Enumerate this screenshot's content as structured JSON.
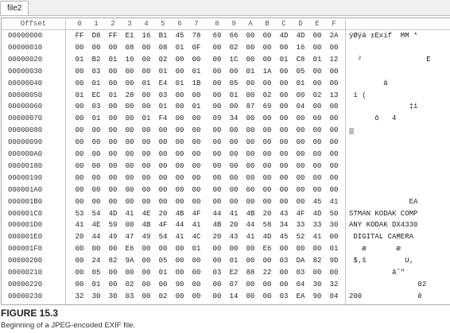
{
  "tab": {
    "label": "file2"
  },
  "header": {
    "offset_label": "Offset",
    "columns": [
      "0",
      "1",
      "2",
      "3",
      "4",
      "5",
      "6",
      "7",
      "8",
      "9",
      "A",
      "B",
      "C",
      "D",
      "E",
      "F"
    ]
  },
  "rows": [
    {
      "offset": "00000000",
      "hex": [
        "FF",
        "D8",
        "FF",
        "E1",
        "16",
        "B1",
        "45",
        "78",
        "69",
        "66",
        "00",
        "00",
        "4D",
        "4D",
        "00",
        "2A"
      ],
      "ascii": "ÿØÿá ±Exif  MM *"
    },
    {
      "offset": "00000010",
      "hex": [
        "00",
        "00",
        "00",
        "08",
        "00",
        "08",
        "01",
        "0F",
        "00",
        "02",
        "00",
        "00",
        "00",
        "16",
        "00",
        "00"
      ],
      "ascii": ""
    },
    {
      "offset": "00000020",
      "hex": [
        "01",
        "B2",
        "01",
        "10",
        "00",
        "02",
        "00",
        "00",
        "00",
        "1C",
        "00",
        "00",
        "01",
        "C8",
        "01",
        "12"
      ],
      "ascii": "  ²               È"
    },
    {
      "offset": "00000030",
      "hex": [
        "00",
        "03",
        "00",
        "00",
        "00",
        "01",
        "00",
        "01",
        "00",
        "00",
        "01",
        "1A",
        "00",
        "05",
        "00",
        "00"
      ],
      "ascii": ""
    },
    {
      "offset": "00000040",
      "hex": [
        "00",
        "01",
        "00",
        "00",
        "01",
        "E4",
        "01",
        "1B",
        "00",
        "05",
        "00",
        "00",
        "00",
        "01",
        "00",
        "00"
      ],
      "ascii": "        ä"
    },
    {
      "offset": "00000050",
      "hex": [
        "01",
        "EC",
        "01",
        "28",
        "00",
        "03",
        "00",
        "00",
        "00",
        "01",
        "00",
        "02",
        "00",
        "00",
        "02",
        "13"
      ],
      "ascii": " ì ("
    },
    {
      "offset": "00000060",
      "hex": [
        "00",
        "03",
        "00",
        "00",
        "00",
        "01",
        "00",
        "01",
        "00",
        "00",
        "87",
        "69",
        "00",
        "04",
        "00",
        "00"
      ],
      "ascii": "              ‡i"
    },
    {
      "offset": "00000070",
      "hex": [
        "00",
        "01",
        "00",
        "00",
        "01",
        "F4",
        "00",
        "00",
        "09",
        "34",
        "00",
        "00",
        "00",
        "00",
        "00",
        "00"
      ],
      "ascii": "      ô   4"
    },
    {
      "offset": "00000080",
      "hex": [
        "00",
        "00",
        "00",
        "00",
        "00",
        "00",
        "00",
        "00",
        "00",
        "00",
        "00",
        "00",
        "00",
        "00",
        "00",
        "00"
      ],
      "ascii": ""
    },
    {
      "offset": "00000090",
      "hex": [
        "00",
        "00",
        "00",
        "00",
        "00",
        "00",
        "00",
        "00",
        "00",
        "00",
        "00",
        "00",
        "00",
        "00",
        "00",
        "00"
      ],
      "ascii": ""
    },
    {
      "offset": "000000A0",
      "hex": [
        "00",
        "00",
        "00",
        "00",
        "00",
        "00",
        "00",
        "00",
        "00",
        "00",
        "00",
        "00",
        "00",
        "00",
        "00",
        "00"
      ],
      "ascii": ""
    },
    {
      "offset": "00000180",
      "hex": [
        "00",
        "00",
        "00",
        "00",
        "00",
        "00",
        "00",
        "00",
        "00",
        "00",
        "00",
        "00",
        "00",
        "00",
        "00",
        "00"
      ],
      "ascii": ""
    },
    {
      "offset": "00000190",
      "hex": [
        "00",
        "00",
        "00",
        "00",
        "00",
        "00",
        "00",
        "00",
        "00",
        "00",
        "00",
        "00",
        "00",
        "00",
        "00",
        "00"
      ],
      "ascii": ""
    },
    {
      "offset": "000001A0",
      "hex": [
        "00",
        "00",
        "00",
        "00",
        "00",
        "00",
        "00",
        "00",
        "00",
        "00",
        "00",
        "00",
        "00",
        "00",
        "00",
        "00"
      ],
      "ascii": ""
    },
    {
      "offset": "000001B0",
      "hex": [
        "00",
        "00",
        "00",
        "00",
        "00",
        "00",
        "00",
        "00",
        "00",
        "00",
        "00",
        "00",
        "00",
        "00",
        "45",
        "41"
      ],
      "ascii": "              EA"
    },
    {
      "offset": "000001C0",
      "hex": [
        "53",
        "54",
        "4D",
        "41",
        "4E",
        "20",
        "4B",
        "4F",
        "44",
        "41",
        "4B",
        "20",
        "43",
        "4F",
        "4D",
        "50"
      ],
      "ascii": "STMAN KODAK COMP"
    },
    {
      "offset": "000001D0",
      "hex": [
        "41",
        "4E",
        "59",
        "00",
        "4B",
        "4F",
        "44",
        "41",
        "4B",
        "20",
        "44",
        "58",
        "34",
        "33",
        "33",
        "30"
      ],
      "ascii": "ANY KODAK DX4330"
    },
    {
      "offset": "000001E0",
      "hex": [
        "20",
        "44",
        "49",
        "47",
        "49",
        "54",
        "41",
        "4C",
        "20",
        "43",
        "41",
        "4D",
        "45",
        "52",
        "41",
        "00"
      ],
      "ascii": " DIGITAL CAMERA"
    },
    {
      "offset": "000001F0",
      "hex": [
        "00",
        "00",
        "00",
        "E6",
        "00",
        "00",
        "00",
        "01",
        "00",
        "00",
        "00",
        "E6",
        "00",
        "00",
        "00",
        "01"
      ],
      "ascii": "   æ       æ"
    },
    {
      "offset": "00000200",
      "hex": [
        "00",
        "24",
        "82",
        "9A",
        "00",
        "05",
        "00",
        "00",
        "00",
        "01",
        "00",
        "00",
        "03",
        "DA",
        "82",
        "9D"
      ],
      "ascii": " $‚š         Ú‚"
    },
    {
      "offset": "00000210",
      "hex": [
        "00",
        "05",
        "00",
        "00",
        "00",
        "01",
        "00",
        "00",
        "03",
        "E2",
        "88",
        "22",
        "00",
        "03",
        "00",
        "00"
      ],
      "ascii": "          âˆ\""
    },
    {
      "offset": "00000220",
      "hex": [
        "00",
        "01",
        "00",
        "02",
        "00",
        "00",
        "90",
        "00",
        "00",
        "07",
        "00",
        "00",
        "00",
        "04",
        "30",
        "32"
      ],
      "ascii": "                02"
    },
    {
      "offset": "00000230",
      "hex": [
        "32",
        "30",
        "30",
        "03",
        "00",
        "02",
        "00",
        "00",
        "00",
        "14",
        "00",
        "00",
        "03",
        "EA",
        "90",
        "04"
      ],
      "ascii": "200             ê"
    }
  ],
  "figure": {
    "title": "FIGURE 15.3",
    "caption": "Beginning of a JPEG-encoded EXIF file."
  }
}
